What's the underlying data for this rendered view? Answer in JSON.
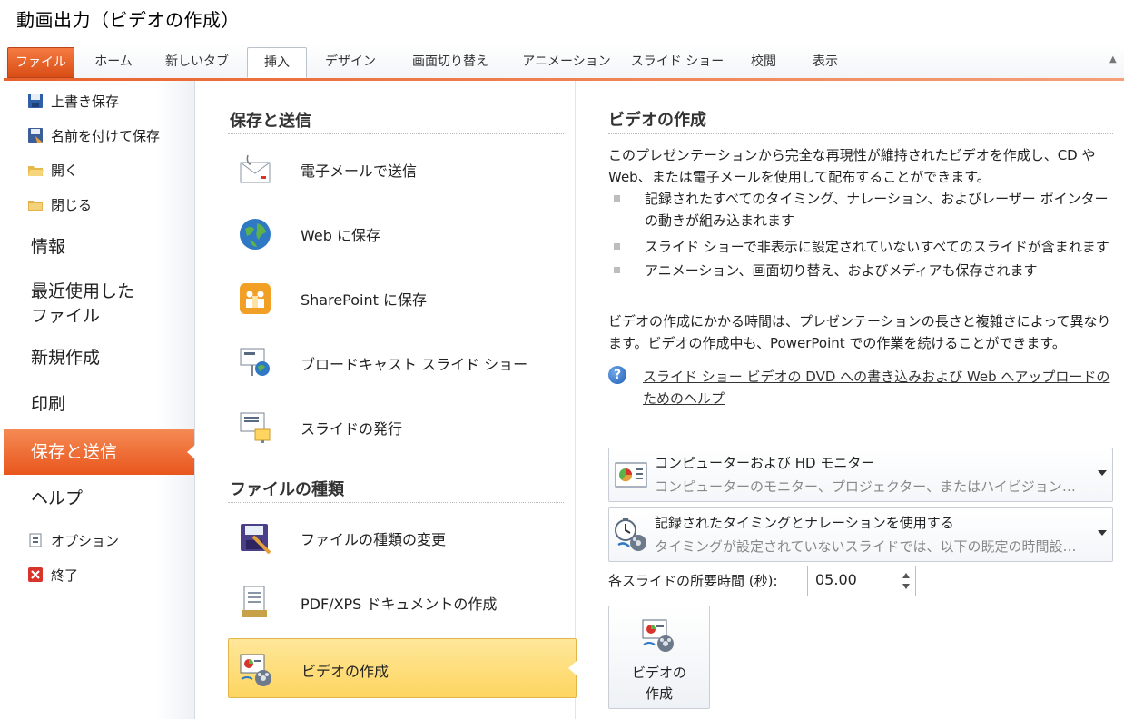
{
  "caption": "動画出力（ビデオの作成）",
  "ribbon": {
    "tabs": [
      "ファイル",
      "ホーム",
      "新しいタブ",
      "挿入",
      "デザイン",
      "画面切り替え",
      "アニメーション",
      "スライド ショー",
      "校閲",
      "表示"
    ],
    "active_tab": "挿入"
  },
  "nav": {
    "save": "上書き保存",
    "save_as": "名前を付けて保存",
    "open": "開く",
    "close": "閉じる",
    "info": "情報",
    "recent_line1": "最近使用した",
    "recent_line2": "ファイル",
    "new": "新規作成",
    "print": "印刷",
    "save_send": "保存と送信",
    "help": "ヘルプ",
    "options": "オプション",
    "exit": "終了"
  },
  "middle": {
    "section1": "保存と送信",
    "items1": [
      "電子メールで送信",
      "Web に保存",
      "SharePoint に保存",
      "ブロードキャスト スライド ショー",
      "スライドの発行"
    ],
    "section2": "ファイルの種類",
    "items2": [
      "ファイルの種類の変更",
      "PDF/XPS ドキュメントの作成",
      "ビデオの作成"
    ]
  },
  "right": {
    "title": "ビデオの作成",
    "desc": "このプレゼンテーションから完全な再現性が維持されたビデオを作成し、CD や Web、または電子メールを使用して配布することができます。",
    "bullets": [
      "記録されたすべてのタイミング、ナレーション、およびレーザー ポインターの動きが組み込まれます",
      "スライド ショーで非表示に設定されていないすべてのスライドが含まれます",
      "アニメーション、画面切り替え、およびメディアも保存されます"
    ],
    "time_note": "ビデオの作成にかかる時間は、プレゼンテーションの長さと複雑さによって異なります。ビデオの作成中も、PowerPoint での作業を続けることができます。",
    "help_link": "スライド ショー ビデオの DVD への書き込みおよび Web へアップロードのためのヘルプ",
    "quality": {
      "title": "コンピューターおよび HD モニター",
      "subtitle": "コンピューターのモニター、プロジェクター、またはハイビジョン表示用…"
    },
    "timing": {
      "title": "記録されたタイミングとナレーションを使用する",
      "subtitle": "タイミングが設定されていないスライドでは、以下の既定の時間設…"
    },
    "duration_label": "各スライドの所要時間 (秒):",
    "duration_value": "05.00",
    "create_button_line1": "ビデオの",
    "create_button_line2": "作成"
  }
}
